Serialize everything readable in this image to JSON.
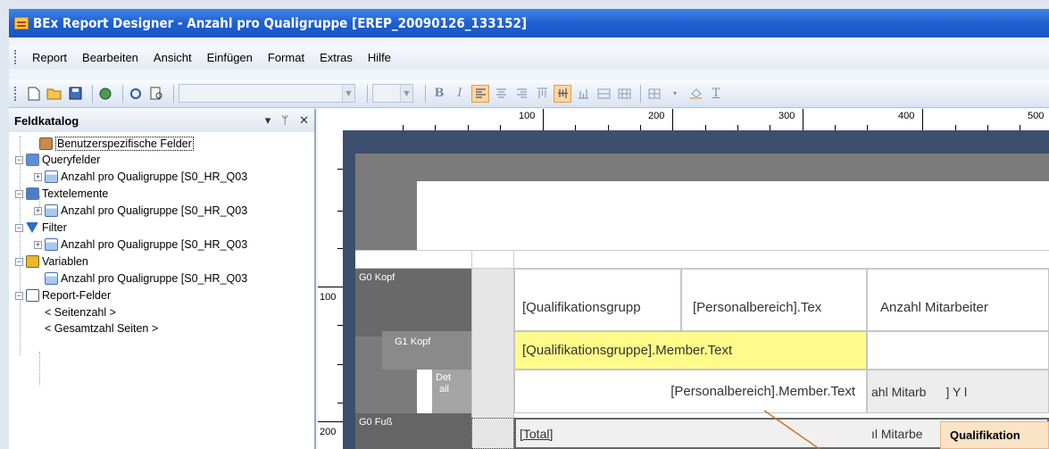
{
  "window": {
    "title": "BEx Report Designer - Anzahl pro Qualigruppe [EREP_20090126_133152]"
  },
  "menu": {
    "items": [
      "Report",
      "Bearbeiten",
      "Ansicht",
      "Einfügen",
      "Format",
      "Extras",
      "Hilfe"
    ]
  },
  "toolbar": {
    "font_combo": "",
    "size_combo": "",
    "bold": "B",
    "italic": "I",
    "underline": "T"
  },
  "panel": {
    "title": "Feldkatalog",
    "controls": {
      "dropdown": "▾",
      "pin": "ᚔ",
      "close": "✕"
    },
    "tree": {
      "custom_fields": "Benutzerspezifische Felder",
      "query_fields": "Queryfelder",
      "query_item": "Anzahl pro Qualigruppe [S0_HR_Q03",
      "text_elements": "Textelemente",
      "text_item": "Anzahl pro Qualigruppe [S0_HR_Q03",
      "filter": "Filter",
      "filter_item": "Anzahl pro Qualigruppe [S0_HR_Q03",
      "variables": "Variablen",
      "variables_item": "Anzahl pro Qualigruppe [S0_HR_Q03",
      "report_fields": "Report-Felder",
      "page_number": "< Seitenzahl >",
      "total_pages": "< Gesamtzahl Seiten >"
    }
  },
  "ruler": {
    "top": [
      "100",
      "200",
      "300",
      "400",
      "500"
    ],
    "left": [
      "100",
      "200"
    ]
  },
  "report": {
    "bands": {
      "g0_head": "G0 Kopf",
      "g1_head": "G1 Kopf",
      "detail_1": "Det",
      "detail_2": "ail",
      "g0_foot": "G0 Fuß"
    },
    "header_cells": [
      "[Qualifikationsgrupp",
      "[Personalbereich].Tex",
      "Anzahl Mitarbeiter"
    ],
    "group_cell": "[Qualifikationsgruppe].Member.Text",
    "detail_cell": "[Personalbereich].Member.Text",
    "detail_right": "ahl Mitarb",
    "detail_right_2": "] Y l",
    "total_cell": "[Total]",
    "total_right": "ıl Mitarbe",
    "popup_label": "Qualifikation"
  },
  "colors": {
    "accent_yellow": "#fffb8a",
    "popup": "#fbe3c8",
    "title_blue": "#2563d6",
    "active_format": "#fbd6a7"
  }
}
